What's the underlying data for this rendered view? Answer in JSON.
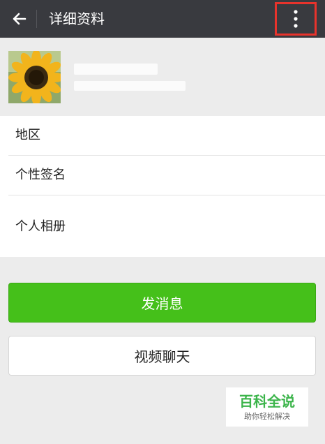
{
  "header": {
    "title": "详细资料",
    "back_icon": "arrow-left-icon",
    "menu_icon": "more-vertical-icon",
    "highlight_color": "#e8332c"
  },
  "profile": {
    "avatar": "sunflower-avatar"
  },
  "info_rows": [
    {
      "label": "地区"
    },
    {
      "label": "个性签名"
    },
    {
      "label": "个人相册"
    }
  ],
  "actions": {
    "send_message": "发消息",
    "video_call": "视频聊天",
    "accent_color": "#45c01a"
  },
  "watermark": {
    "title": "百科全说",
    "subtitle": "助你轻松解决"
  }
}
